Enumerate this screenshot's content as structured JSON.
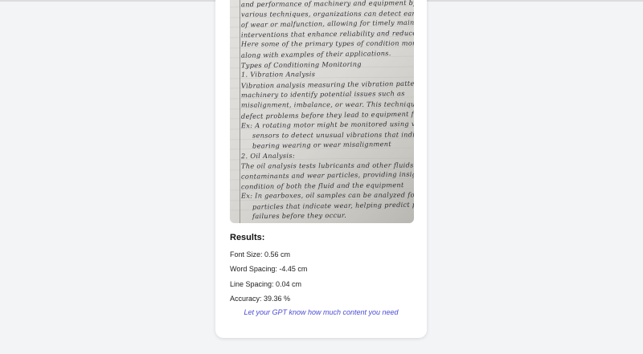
{
  "document_lines": [
    "and performance of machinery and equipment by utilizing",
    "various techniques, organizations can detect early signs",
    "of wear or malfunction, allowing for timely maintenance",
    "interventions that enhance reliability and reduce costs.",
    "Here some of the primary types of condition monitoring,",
    "along with examples of their applications.",
    "Types of Conditioning Monitoring",
    "1. Vibration Analysis",
    "Vibration analysis measuring the vibration patterns of",
    "machinery to identify potential issues such as",
    "misalignment, imbalance, or wear. This technique can",
    "defect problems before they lead to equipment failure",
    "Ex: A rotating motor might be monitored using vibration",
    "sensors to detect unusual vibrations that indicate",
    "bearing wearing or wear misalignment",
    "2. Oil Analysis:",
    "The oil analysis tests lubricants and other fluids for",
    "contaminants and wear particles, providing insights into",
    "condition of both the fluid and the equipment",
    "Ex: In gearboxes, oil samples can be analyzed for metal",
    "particles that indicate wear, helping predict potential",
    "failures before they occur."
  ],
  "results": {
    "title": "Results:",
    "font_size": "Font Size: 0.56 cm",
    "word_spacing": "Word Spacing: -4.45 cm",
    "line_spacing": "Line Spacing: 0.04 cm",
    "accuracy": "Accuracy: 39.36 %"
  },
  "note": "Let your GPT know how much content you need"
}
